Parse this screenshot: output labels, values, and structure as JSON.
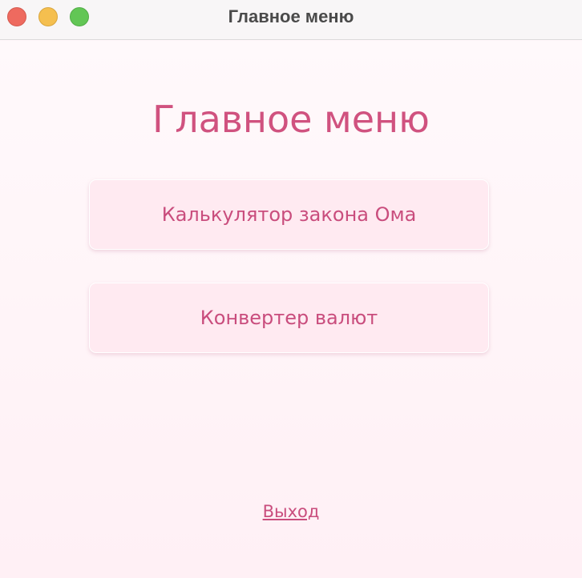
{
  "window": {
    "title": "Главное меню"
  },
  "main": {
    "heading": "Главное меню",
    "buttons": [
      {
        "label": "Калькулятор закона Ома"
      },
      {
        "label": "Конвертер валют"
      }
    ],
    "exit_label": "Выход"
  },
  "colors": {
    "accent": "#d0527f",
    "button_background": "#ffeaf1",
    "page_background": "#fff7fa"
  }
}
